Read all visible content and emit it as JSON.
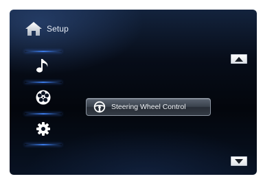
{
  "header": {
    "title": "Setup",
    "icon": "home-icon"
  },
  "sidebar": {
    "items": [
      {
        "name": "audio",
        "icon": "music-note-icon"
      },
      {
        "name": "video",
        "icon": "film-reel-icon"
      },
      {
        "name": "settings",
        "icon": "gear-icon"
      }
    ]
  },
  "main": {
    "buttons": [
      {
        "label": "Steering Wheel Control",
        "icon": "steering-wheel-icon"
      }
    ]
  },
  "scroll": {
    "up_icon": "triangle-up-icon",
    "down_icon": "triangle-down-icon"
  },
  "colors": {
    "accent_separator": "#3b7be8",
    "background": "#050a14",
    "text": "#e6ecf5"
  }
}
